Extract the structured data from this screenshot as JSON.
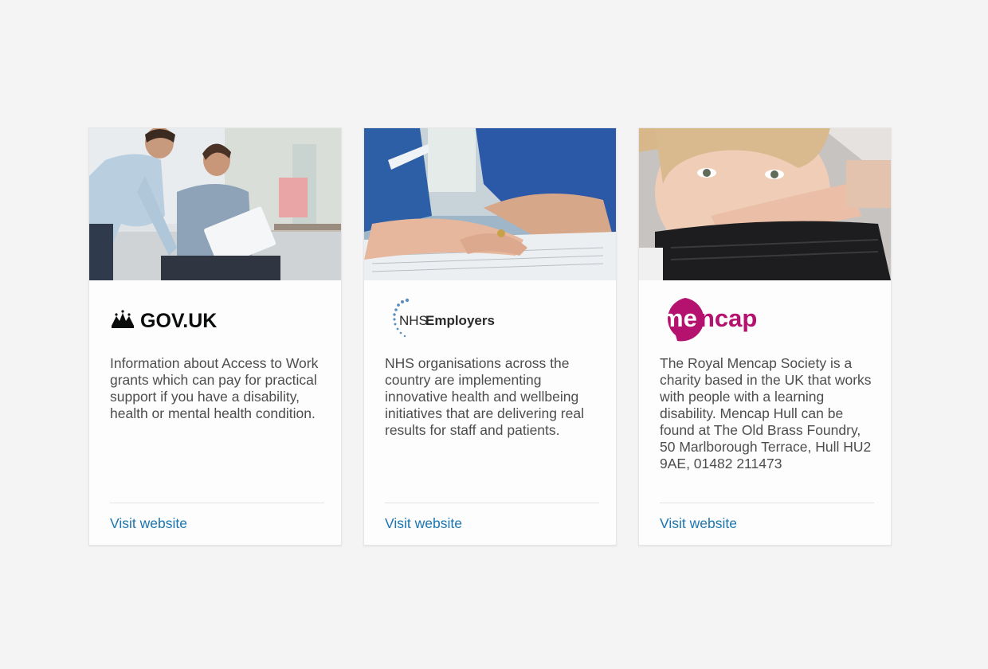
{
  "cards": [
    {
      "logo_text": "GOV.UK",
      "description": "Information about Access to Work grants which can pay for practical support if you have a disability, health or mental health condition.",
      "link_label": "Visit website"
    },
    {
      "logo_text_1": "NHS",
      "logo_text_2": "Employers",
      "description": "NHS organisations across the country are implementing innovative health and wellbeing initiatives that are delivering real results for staff and patients.",
      "link_label": "Visit website"
    },
    {
      "logo_text_1": "me",
      "logo_text_2": "ncap",
      "description": "The Royal Mencap Society is a charity based in the UK that works with people with a learning disability. Mencap Hull can be found at The Old Brass Foundry, 50 Marlborough Terrace, Hull HU2 9AE, 01482 211473",
      "link_label": "Visit website"
    }
  ],
  "colors": {
    "link": "#1a75b0",
    "body_text": "#4d4d4d",
    "mencap_brand": "#b5126f",
    "nhs_dots": "#5b8fc0"
  }
}
